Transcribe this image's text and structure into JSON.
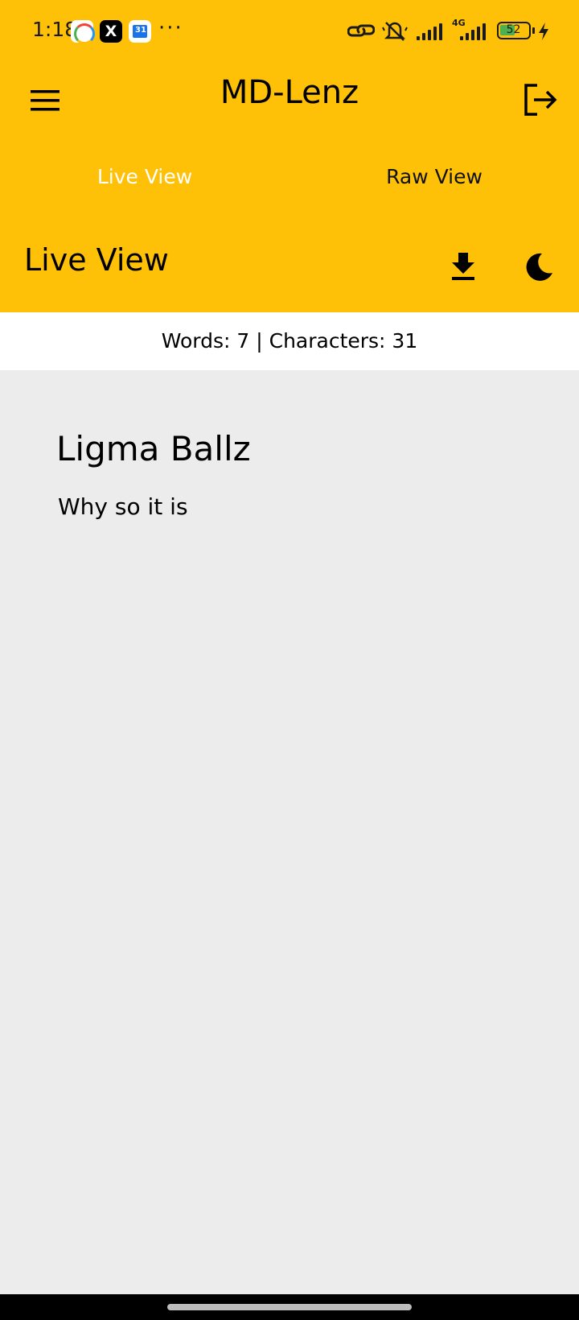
{
  "status_bar": {
    "time": "1:18",
    "x_app_glyph": "X",
    "more": "···",
    "network": "4G",
    "battery": "52"
  },
  "app_bar": {
    "title": "MD-Lenz"
  },
  "tabs": [
    {
      "label": "Live View",
      "active": true
    },
    {
      "label": "Raw View",
      "active": false
    }
  ],
  "toolbar": {
    "title": "Live View"
  },
  "stats": {
    "text": "Words: 7 | Characters: 31"
  },
  "document": {
    "heading": "Ligma Ballz",
    "paragraph": "Why so it is"
  },
  "colors": {
    "accent": "#FFC107",
    "background": "#ECECEC",
    "active_tab": "#FFFFFF"
  },
  "icons": [
    "menu-icon",
    "logout-icon",
    "download-icon",
    "moon-icon"
  ]
}
